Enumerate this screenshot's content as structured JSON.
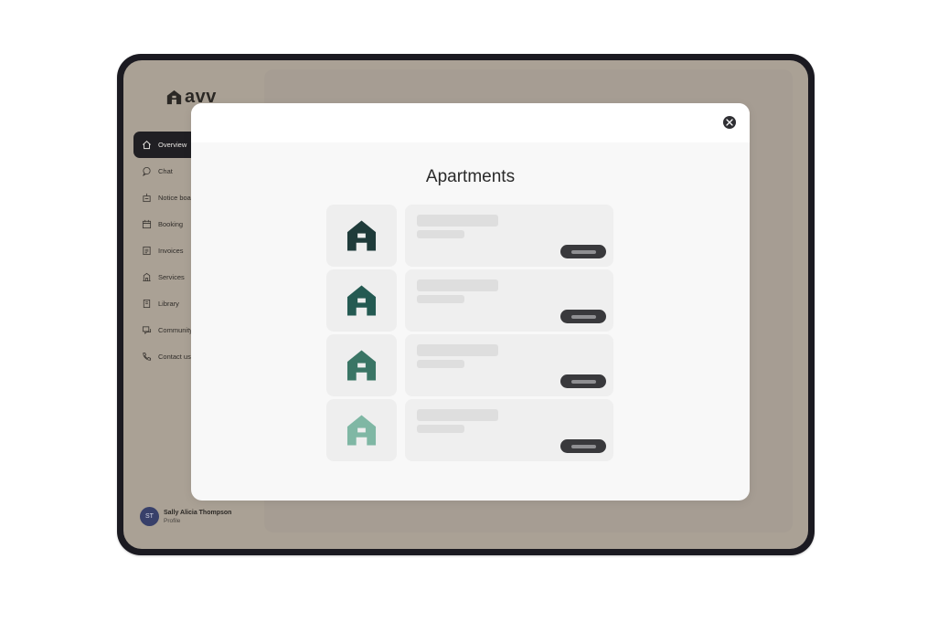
{
  "app": {
    "logo_text": "avv",
    "nav": [
      {
        "label": "Overview",
        "icon": "home-icon",
        "active": true
      },
      {
        "label": "Chat",
        "icon": "chat-icon"
      },
      {
        "label": "Notice boa",
        "icon": "notice-board-icon"
      },
      {
        "label": "Booking",
        "icon": "calendar-icon"
      },
      {
        "label": "Invoices",
        "icon": "invoice-icon"
      },
      {
        "label": "Services",
        "icon": "services-icon"
      },
      {
        "label": "Library",
        "icon": "library-icon"
      },
      {
        "label": "Community",
        "icon": "community-icon"
      },
      {
        "label": "Contact us",
        "icon": "phone-icon"
      }
    ],
    "profile": {
      "initials": "ST",
      "name": "Sally Alicia Thompson",
      "subtitle": "Profile"
    }
  },
  "modal": {
    "title": "Apartments",
    "close_icon": "close-icon",
    "apartments": [
      {
        "icon": "house-icon",
        "color": "#1f3b3a"
      },
      {
        "icon": "house-icon",
        "color": "#245a52"
      },
      {
        "icon": "house-icon",
        "color": "#3a7565"
      },
      {
        "icon": "house-icon",
        "color": "#7fb7a4"
      }
    ]
  }
}
